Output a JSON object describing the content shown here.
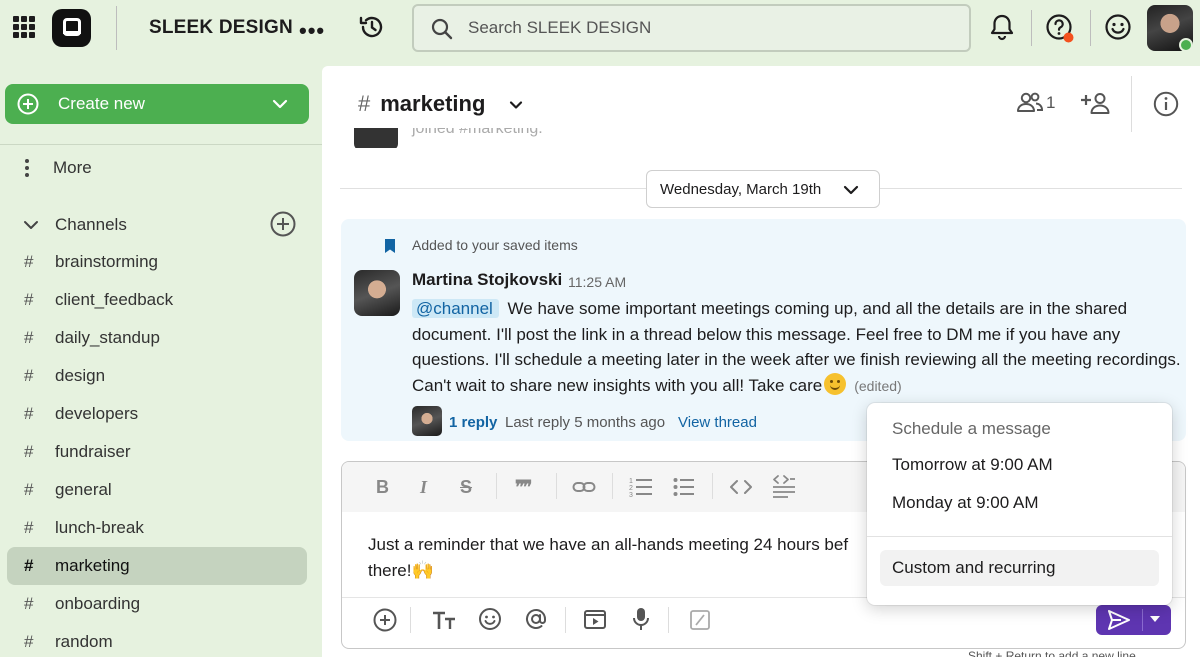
{
  "topbar": {
    "workspace_name": "SLEEK DESIGN",
    "more_label": "•••",
    "search_placeholder": "Search SLEEK DESIGN"
  },
  "sidebar": {
    "create_new_label": "Create new",
    "more_label": "More",
    "channels_label": "Channels",
    "channels": [
      {
        "name": "brainstorming"
      },
      {
        "name": "client_feedback"
      },
      {
        "name": "daily_standup"
      },
      {
        "name": "design"
      },
      {
        "name": "developers"
      },
      {
        "name": "fundraiser"
      },
      {
        "name": "general"
      },
      {
        "name": "lunch-break"
      },
      {
        "name": "marketing",
        "active": true
      },
      {
        "name": "onboarding"
      },
      {
        "name": "random"
      }
    ]
  },
  "channel": {
    "hash": "#",
    "name": "marketing",
    "member_count": "1",
    "previous_message": "joined #marketing."
  },
  "day_divider": {
    "label": "Wednesday, March 19th"
  },
  "message": {
    "saved_label": "Added to your saved items",
    "author": "Martina Stojkovski",
    "time": "11:25 AM",
    "mention": "@channel",
    "text": "We have some important meetings coming up, and all the details are in the shared document. I'll post the link in a thread below this message. Feel free to DM me if you have any questions. I'll schedule a meeting later in the week after we finish reviewing all the meeting recordings. Can't wait to share new insights with you all! Take care",
    "edited": "(edited)",
    "reply_count": "1 reply",
    "last_reply": "Last reply 5 months ago",
    "view_thread": "View thread"
  },
  "composer": {
    "draft_line1": "Just a reminder that we have an all-hands meeting 24 hours bef",
    "draft_line2": "there!",
    "hint": "Shift + Return to add a new line"
  },
  "schedule_menu": {
    "title": "Schedule a message",
    "options": [
      "Tomorrow at 9:00 AM",
      "Monday at 9:00 AM"
    ],
    "custom": "Custom and recurring"
  },
  "colors": {
    "accent_green": "#4caf50",
    "send_purple": "#5e35b1",
    "link_blue": "#1264a3",
    "sidebar_bg": "#e6f2df"
  }
}
